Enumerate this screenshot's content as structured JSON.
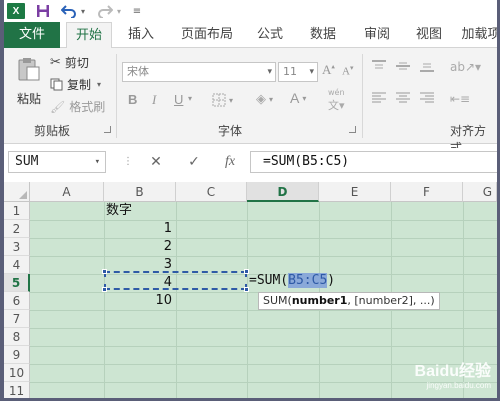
{
  "quick_access": {
    "app_icon": "excel-icon",
    "save_icon": "save-icon",
    "undo_icon": "undo-icon",
    "redo_icon": "redo-icon"
  },
  "tabs": [
    {
      "label": "文件"
    },
    {
      "label": "开始"
    },
    {
      "label": "插入"
    },
    {
      "label": "页面布局"
    },
    {
      "label": "公式"
    },
    {
      "label": "数据"
    },
    {
      "label": "审阅"
    },
    {
      "label": "视图"
    },
    {
      "label": "加载项"
    }
  ],
  "ribbon": {
    "paste_label": "粘贴",
    "cut_label": "剪切",
    "copy_label": "复制",
    "format_painter_label": "格式刷",
    "clipboard_group": "剪贴板",
    "font_name": "宋体",
    "font_size": "11",
    "font_group": "字体",
    "bold": "B",
    "italic": "I",
    "underline": "U",
    "font_color_glyph": "A",
    "phonetic_glyph": "wén",
    "alignment_group": "对齐方式"
  },
  "formula_bar": {
    "name_box": "SUM",
    "cancel_glyph": "✕",
    "enter_glyph": "✓",
    "fx_glyph": "fx",
    "formula": "=SUM(B5:C5)"
  },
  "grid": {
    "columns": [
      "A",
      "B",
      "C",
      "D",
      "E",
      "F",
      "G"
    ],
    "rows": [
      "1",
      "2",
      "3",
      "4",
      "5",
      "6",
      "7",
      "8",
      "9",
      "10",
      "11"
    ],
    "selected_column": "D",
    "selected_row": "5",
    "cells": {
      "B1": "数字",
      "B2": "1",
      "B3": "2",
      "B4": "3",
      "B5": "4",
      "B6": "10"
    },
    "edit_cell": {
      "prefix": "=SUM(",
      "ref": "B5:C5",
      "suffix": ")"
    },
    "tooltip": {
      "fn": "SUM(",
      "arg1": "number1",
      "rest": ", [number2], ...)"
    }
  },
  "watermark": {
    "text": "Baidu经验",
    "sub": "jingyan.baidu.com"
  },
  "colors": {
    "excel_green": "#217346",
    "sheet_bg": "#cde5d2",
    "marquee": "#2e5aa6"
  }
}
